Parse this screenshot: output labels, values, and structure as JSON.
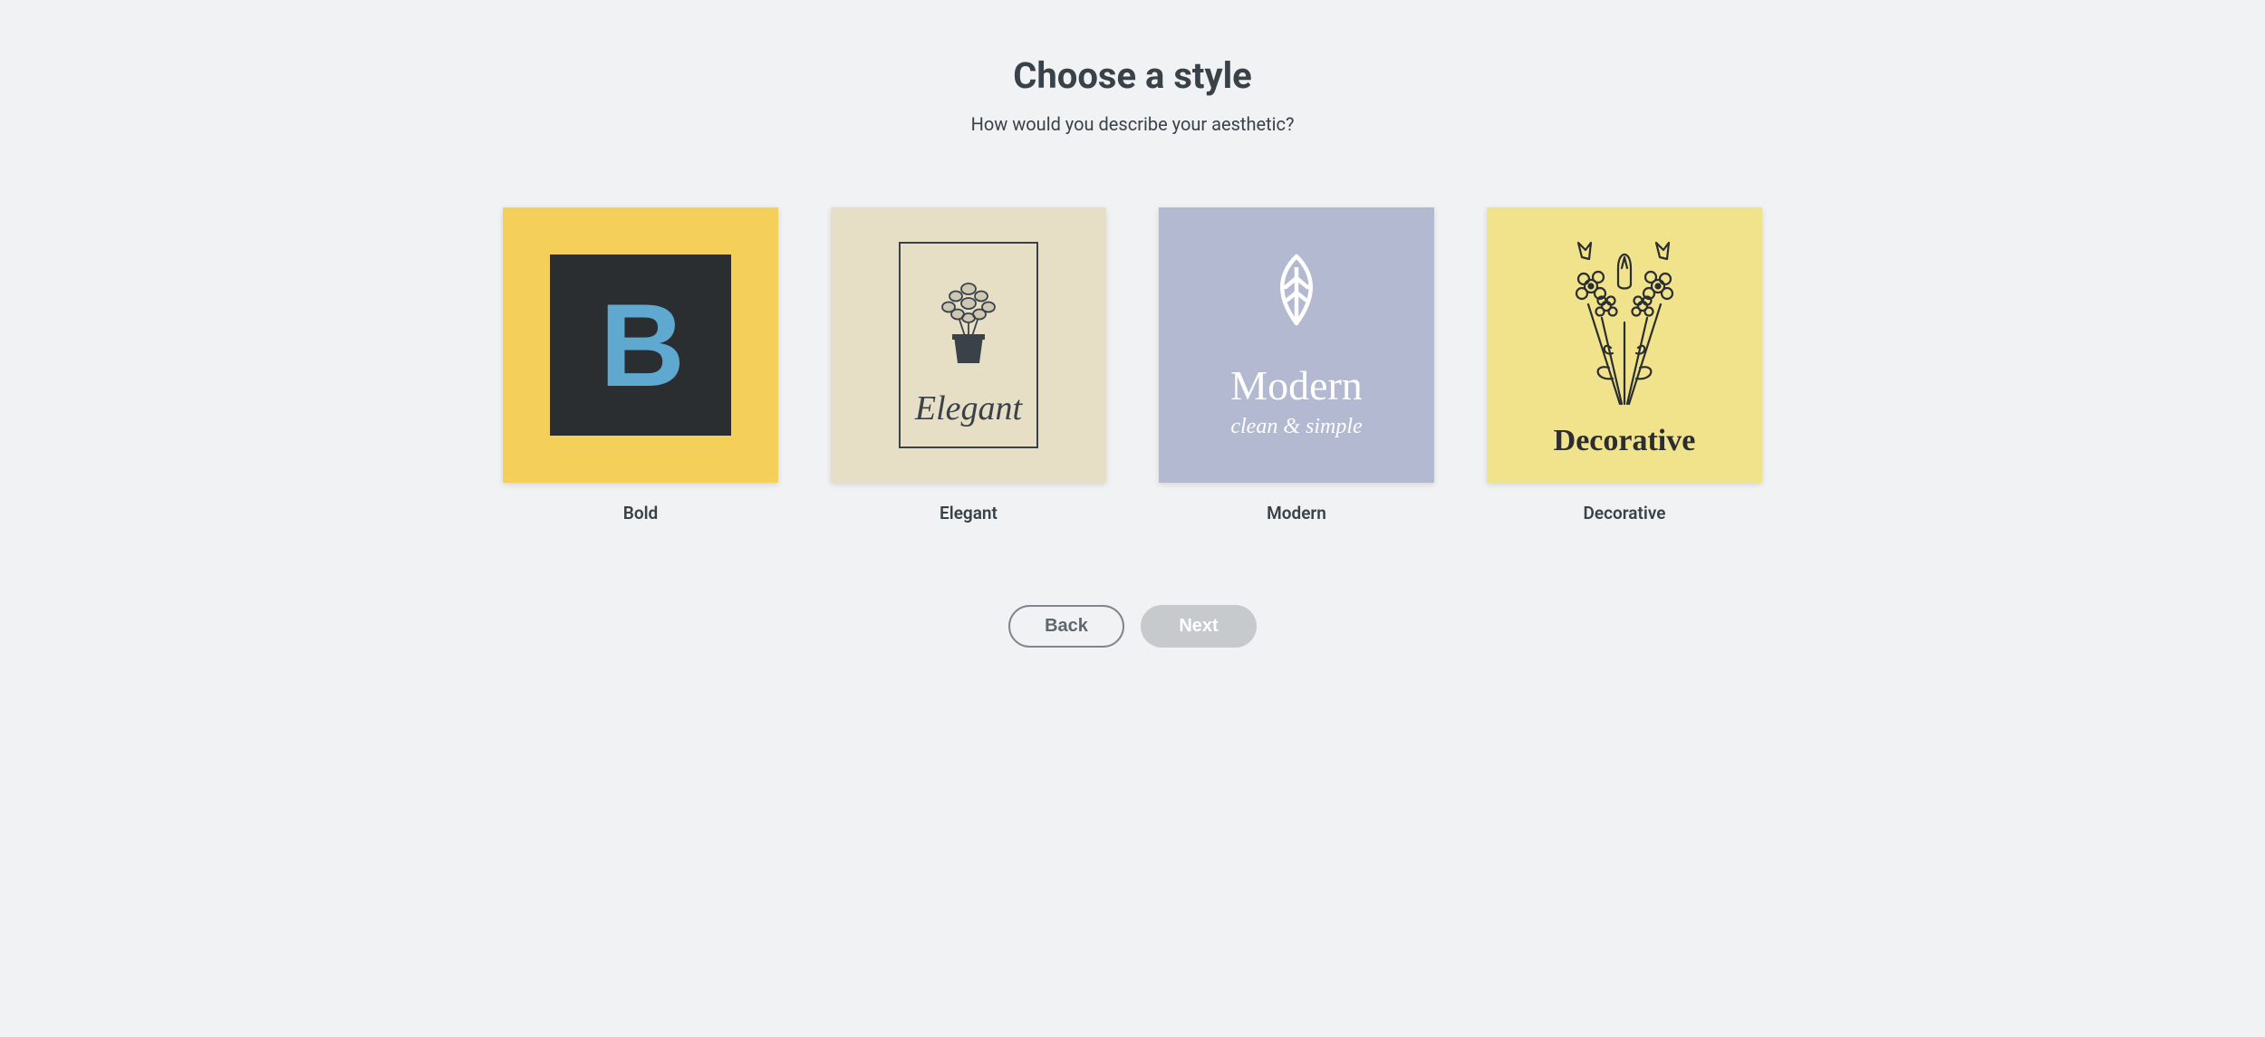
{
  "heading": "Choose a style",
  "subheading": "How would you describe your aesthetic?",
  "styles": [
    {
      "label": "Bold",
      "card_text_main": "B"
    },
    {
      "label": "Elegant",
      "card_text_main": "Elegant"
    },
    {
      "label": "Modern",
      "card_text_main": "Modern",
      "card_text_sub": "clean & simple"
    },
    {
      "label": "Decorative",
      "card_text_main": "Decorative"
    }
  ],
  "buttons": {
    "back": "Back",
    "next": "Next"
  }
}
